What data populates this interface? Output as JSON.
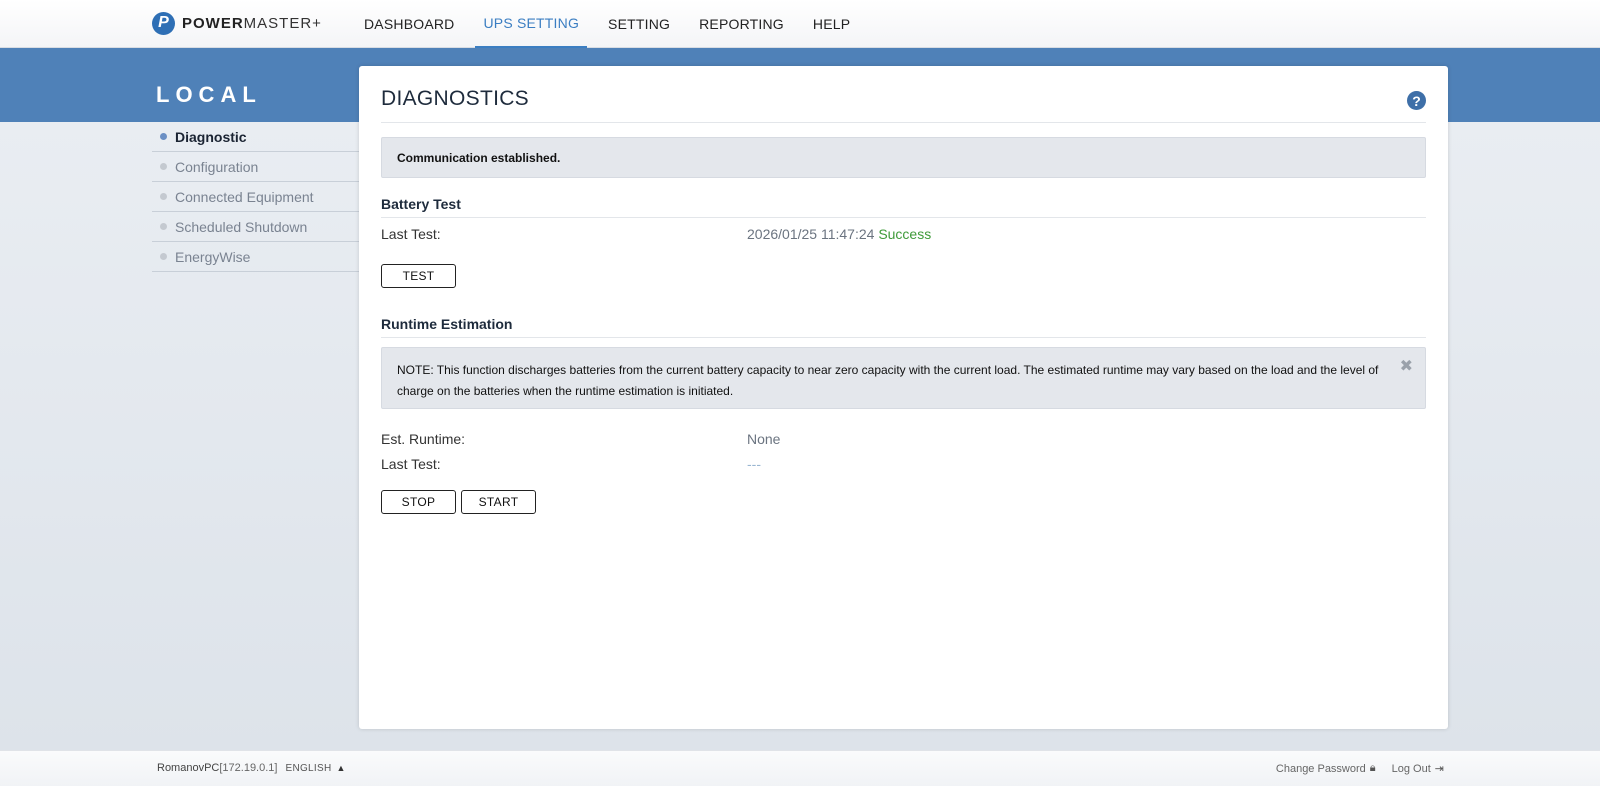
{
  "brand": {
    "mark": "P",
    "name_bold": "POWER",
    "name_light": "MASTER+"
  },
  "nav": [
    {
      "label": "DASHBOARD",
      "active": false
    },
    {
      "label": "UPS SETTING",
      "active": true
    },
    {
      "label": "SETTING",
      "active": false
    },
    {
      "label": "REPORTING",
      "active": false
    },
    {
      "label": "HELP",
      "active": false
    }
  ],
  "sidebar": {
    "title": "LOCAL",
    "items": [
      {
        "label": "Diagnostic",
        "active": true
      },
      {
        "label": "Configuration",
        "active": false
      },
      {
        "label": "Connected Equipment",
        "active": false
      },
      {
        "label": "Scheduled Shutdown",
        "active": false
      },
      {
        "label": "EnergyWise",
        "active": false
      }
    ]
  },
  "main": {
    "title": "DIAGNOSTICS",
    "help_icon": "question-icon",
    "status_message": "Communication established.",
    "battery_test": {
      "heading": "Battery Test",
      "last_test_label": "Last Test:",
      "last_test_time": "2026/01/25 11:47:24",
      "last_test_result": "Success",
      "test_button": "TEST"
    },
    "runtime": {
      "heading": "Runtime Estimation",
      "note": "NOTE: This function discharges batteries from the current battery capacity to near zero capacity with the current load. The estimated runtime may vary based on the load and the level of charge on the batteries when the runtime estimation is initiated.",
      "est_runtime_label": "Est. Runtime:",
      "est_runtime_value": "None",
      "last_test_label": "Last Test:",
      "last_test_value": "---",
      "stop_button": "STOP",
      "start_button": "START"
    }
  },
  "footer": {
    "host": "RomanovPC",
    "ip": "[172.19.0.1]",
    "language": "ENGLISH",
    "change_password": "Change Password",
    "log_out": "Log Out"
  },
  "colors": {
    "accent": "#3b7ec2",
    "band": "#4f81b8",
    "success": "#3f9b3a"
  }
}
